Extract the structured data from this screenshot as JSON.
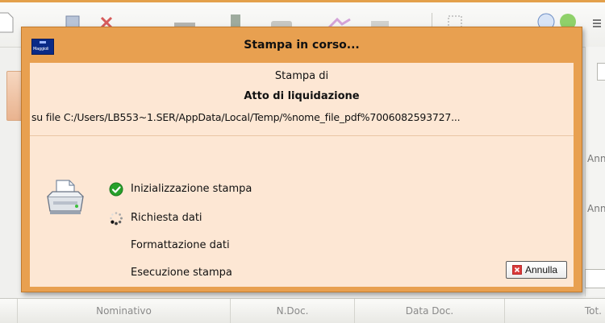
{
  "dialog": {
    "title": "Stampa in corso...",
    "subtitle": "Stampa di",
    "document_name": "Atto di liquidazione",
    "file_line": "su file C:/Users/LB553~1.SER/AppData/Local/Temp/%nome_file_pdf%7006082593727...",
    "cancel_label": "Annulla",
    "steps": [
      {
        "label": "Inizializzazione stampa",
        "status": "done"
      },
      {
        "label": "Richiesta dati",
        "status": "in-progress"
      },
      {
        "label": "Formattazione dati",
        "status": "pending"
      },
      {
        "label": "Esecuzione stampa",
        "status": "pending"
      }
    ],
    "colors": {
      "frame": "#e8a050",
      "content": "#fde7d4",
      "check": "#27a12b",
      "cancel_icon": "#d93a3a"
    }
  },
  "background": {
    "right_labels": [
      "Ann",
      "Ann"
    ],
    "table_headers": [
      "Nominativo",
      "N.Doc.",
      "Data Doc.",
      "Tot."
    ]
  }
}
